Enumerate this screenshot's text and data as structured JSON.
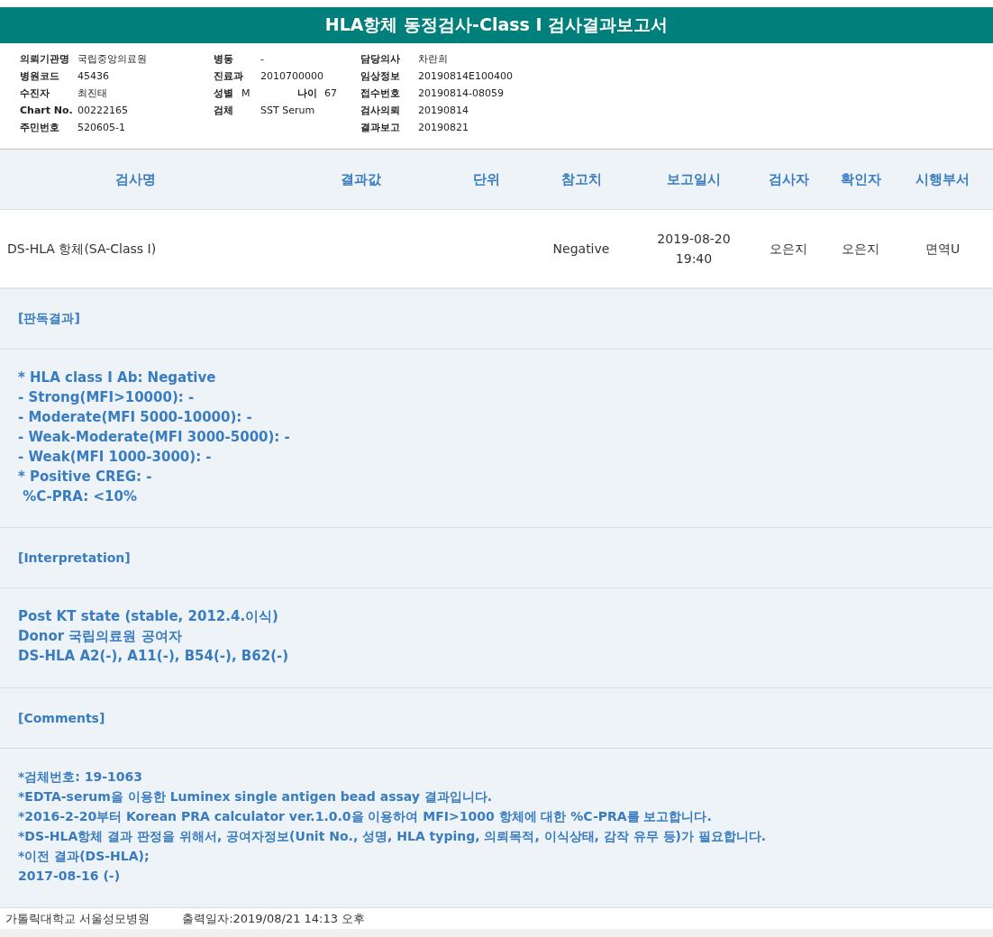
{
  "title": "HLA항체 동정검사-Class I 검사결과보고서",
  "info_columns": [
    [
      {
        "label": "의뢰기관명",
        "value": "국립중앙의료원"
      },
      {
        "label": "병원코드",
        "value": "45436"
      },
      {
        "label": "수진자",
        "value": "최진태"
      },
      {
        "label": "Chart No.",
        "value": "00222165"
      },
      {
        "label": "주민번호",
        "value": "520605-1"
      }
    ],
    [
      {
        "label": "병동",
        "value": "-"
      },
      {
        "label": "진료과",
        "value": "2010700000"
      },
      {
        "label": "성별",
        "value": "M",
        "sub_label": "나이",
        "sub_value": "67"
      },
      {
        "label": "검체",
        "value": "SST Serum"
      }
    ],
    [
      {
        "label": "담당의사",
        "value": "차란희"
      },
      {
        "label": "임상정보",
        "value": "20190814E100400"
      },
      {
        "label": "접수번호",
        "value": "20190814-08059"
      },
      {
        "label": "검사의뢰",
        "value": "20190814"
      },
      {
        "label": "결과보고",
        "value": "20190821"
      }
    ]
  ],
  "table": {
    "columns": [
      "검사명",
      "결과값",
      "단위",
      "참고치",
      "보고일시",
      "검사자",
      "확인자",
      "시행부서"
    ],
    "rows": [
      [
        "DS-HLA 항체(SA-Class I)",
        "",
        "",
        "Negative",
        "2019-08-20\n19:40",
        "오은지",
        "오은지",
        "면역U"
      ]
    ]
  },
  "sections": [
    {
      "heading": "[판독결과]",
      "lines": [
        "* HLA class I Ab: Negative",
        "- Strong(MFI>10000): -",
        "- Moderate(MFI 5000-10000): -",
        "- Weak-Moderate(MFI 3000-5000): -",
        "- Weak(MFI 1000-3000): -",
        "* Positive CREG: -",
        " %C-PRA: <10%"
      ]
    },
    {
      "heading": "[Interpretation]",
      "lines": [
        "Post KT state (stable, 2012.4.이식)",
        "Donor 국립의료원 공여자",
        "DS-HLA A2(-), A11(-), B54(-), B62(-)"
      ]
    },
    {
      "heading": "[Comments]",
      "lines": [
        "*검체번호: 19-1063",
        "*EDTA-serum을 이용한 Luminex single antigen bead assay 결과입니다.",
        "*2016-2-20부터 Korean PRA calculator ver.1.0.0을 이용하여 MFI>1000 항체에 대한 %C-PRA를 보고합니다.",
        "*DS-HLA항체 결과 판정을 위해서, 공여자정보(Unit No., 성명, HLA typing, 의뢰목적, 이식상태, 감작 유무 등)가 필요합니다.",
        "*이전 결과(DS-HLA);",
        "2017-08-16 (-)"
      ]
    }
  ],
  "footer": {
    "hospital": "가톨릭대학교 서울성모병원",
    "printed": "출력일자:2019/08/21 14:13 오후"
  }
}
